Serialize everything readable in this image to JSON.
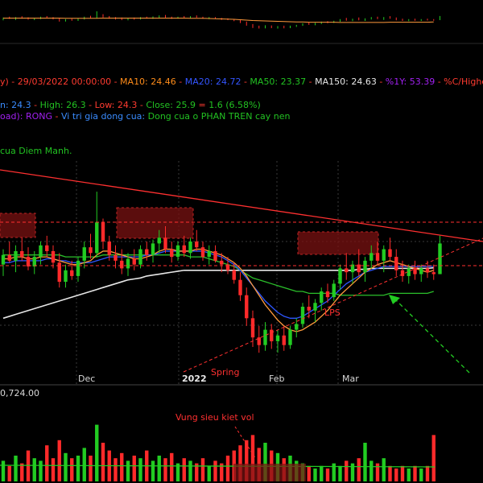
{
  "header": {
    "segments": [
      {
        "text": "y)",
        "color": "#ff3b30"
      },
      {
        "text": " - 29/03/2022 00:00:00 - ",
        "color": "#ff3b30"
      },
      {
        "text": "MA10: 24.46",
        "color": "#ff8c1a"
      },
      {
        "text": " - ",
        "color": "#ff3b30"
      },
      {
        "text": "MA20: 24.72",
        "color": "#3355ff"
      },
      {
        "text": " - ",
        "color": "#ff3b30"
      },
      {
        "text": "MA50: 23.37",
        "color": "#22c222"
      },
      {
        "text": " - ",
        "color": "#ff3b30"
      },
      {
        "text": "MA150: 24.63",
        "color": "#e8e8e8"
      },
      {
        "text": " - ",
        "color": "#ff3b30"
      },
      {
        "text": "%1Y: 53.39",
        "color": "#a020f0"
      },
      {
        "text": " - %C/Highe",
        "color": "#ff3b30"
      }
    ]
  },
  "ohlc": {
    "segments": [
      {
        "text": "n: 24.3",
        "color": "#3a8cff"
      },
      {
        "text": " - ",
        "color": "#ff3b30"
      },
      {
        "text": "High: 26.3",
        "color": "#22c222"
      },
      {
        "text": " - ",
        "color": "#ff3b30"
      },
      {
        "text": "Low: 24.3",
        "color": "#ff3b30"
      },
      {
        "text": " - ",
        "color": "#ff3b30"
      },
      {
        "text": "Close: 25.9",
        "color": "#22c222"
      },
      {
        "text": " = ",
        "color": "#ff3b30"
      },
      {
        "text": "1.6  (6.58%)",
        "color": "#22c222"
      }
    ]
  },
  "status": {
    "segments": [
      {
        "text": "oad): ",
        "color": "#a020f0"
      },
      {
        "text": "RONG",
        "color": "#a020f0"
      },
      {
        "text": "   -   ",
        "color": "#ff3b30"
      },
      {
        "text": "Vi tri gia dong cua:",
        "color": "#3a8cff"
      },
      {
        "text": "  Dong cua o PHAN TREN cay nen",
        "color": "#22c222"
      }
    ]
  },
  "note": {
    "text": "cua Diem Manh.",
    "color": "#22c222"
  },
  "annotations": {
    "lps": "LPS",
    "spring": "Spring",
    "vol_note": "Vung sieu kiet vol"
  },
  "volume_panel": {
    "value_label": "0,724.00"
  },
  "colors": {
    "background": "#000000",
    "up": "#22cc22",
    "down": "#ff2a2a",
    "ma10": "#ff9a3c",
    "ma20": "#2d56ff",
    "ma50": "#2bc02b",
    "ma150": "#e6e6e6",
    "trendline": "#ff3030",
    "resistance_box": "#7a1212",
    "grid": "#3a3a3a"
  },
  "chart_data": {
    "type": "candlestick",
    "x_ticks": [
      "Dec",
      "2022",
      "Feb",
      "Mar"
    ],
    "price_series": [
      {
        "o": 24.8,
        "h": 25.6,
        "l": 24.2,
        "c": 25.3
      },
      {
        "o": 25.3,
        "h": 26.0,
        "l": 24.9,
        "c": 25.0
      },
      {
        "o": 25.0,
        "h": 25.8,
        "l": 24.4,
        "c": 25.5
      },
      {
        "o": 25.5,
        "h": 26.2,
        "l": 25.0,
        "c": 25.2
      },
      {
        "o": 25.2,
        "h": 25.7,
        "l": 24.5,
        "c": 24.7
      },
      {
        "o": 24.7,
        "h": 25.5,
        "l": 24.3,
        "c": 25.2
      },
      {
        "o": 25.2,
        "h": 26.0,
        "l": 24.8,
        "c": 25.8
      },
      {
        "o": 25.8,
        "h": 26.3,
        "l": 25.2,
        "c": 25.5
      },
      {
        "o": 25.5,
        "h": 25.8,
        "l": 24.6,
        "c": 24.9
      },
      {
        "o": 24.9,
        "h": 25.4,
        "l": 23.6,
        "c": 23.9
      },
      {
        "o": 23.9,
        "h": 24.8,
        "l": 23.6,
        "c": 24.5
      },
      {
        "o": 24.5,
        "h": 25.0,
        "l": 24.0,
        "c": 24.2
      },
      {
        "o": 24.2,
        "h": 25.2,
        "l": 23.9,
        "c": 25.0
      },
      {
        "o": 25.0,
        "h": 26.0,
        "l": 24.6,
        "c": 25.7
      },
      {
        "o": 25.7,
        "h": 26.4,
        "l": 25.1,
        "c": 25.4
      },
      {
        "o": 25.4,
        "h": 28.6,
        "l": 25.2,
        "c": 27.0
      },
      {
        "o": 27.0,
        "h": 27.2,
        "l": 25.6,
        "c": 26.0
      },
      {
        "o": 26.0,
        "h": 26.3,
        "l": 25.0,
        "c": 25.3
      },
      {
        "o": 25.3,
        "h": 25.8,
        "l": 24.6,
        "c": 25.0
      },
      {
        "o": 25.0,
        "h": 25.6,
        "l": 24.3,
        "c": 24.6
      },
      {
        "o": 24.6,
        "h": 25.4,
        "l": 24.2,
        "c": 25.1
      },
      {
        "o": 25.1,
        "h": 25.6,
        "l": 24.5,
        "c": 24.8
      },
      {
        "o": 24.8,
        "h": 25.8,
        "l": 24.6,
        "c": 25.6
      },
      {
        "o": 25.6,
        "h": 26.0,
        "l": 25.0,
        "c": 25.3
      },
      {
        "o": 25.3,
        "h": 26.1,
        "l": 24.9,
        "c": 25.9
      },
      {
        "o": 25.9,
        "h": 26.6,
        "l": 25.4,
        "c": 26.2
      },
      {
        "o": 26.2,
        "h": 26.8,
        "l": 25.4,
        "c": 25.6
      },
      {
        "o": 25.6,
        "h": 26.0,
        "l": 24.9,
        "c": 25.2
      },
      {
        "o": 25.2,
        "h": 26.0,
        "l": 25.0,
        "c": 25.8
      },
      {
        "o": 25.8,
        "h": 26.3,
        "l": 25.2,
        "c": 25.4
      },
      {
        "o": 25.4,
        "h": 26.2,
        "l": 25.1,
        "c": 26.0
      },
      {
        "o": 26.0,
        "h": 26.6,
        "l": 25.5,
        "c": 25.7
      },
      {
        "o": 25.7,
        "h": 26.0,
        "l": 25.0,
        "c": 25.2
      },
      {
        "o": 25.2,
        "h": 25.8,
        "l": 24.8,
        "c": 25.5
      },
      {
        "o": 25.5,
        "h": 25.8,
        "l": 24.9,
        "c": 25.0
      },
      {
        "o": 25.0,
        "h": 25.4,
        "l": 24.4,
        "c": 24.8
      },
      {
        "o": 24.8,
        "h": 25.2,
        "l": 24.3,
        "c": 24.5
      },
      {
        "o": 24.5,
        "h": 24.9,
        "l": 23.8,
        "c": 24.0
      },
      {
        "o": 24.0,
        "h": 24.4,
        "l": 22.9,
        "c": 23.2
      },
      {
        "o": 23.2,
        "h": 23.6,
        "l": 21.6,
        "c": 22.0
      },
      {
        "o": 22.0,
        "h": 22.4,
        "l": 20.5,
        "c": 21.0
      },
      {
        "o": 21.0,
        "h": 21.6,
        "l": 20.2,
        "c": 20.6
      },
      {
        "o": 20.6,
        "h": 21.8,
        "l": 20.3,
        "c": 21.4
      },
      {
        "o": 21.4,
        "h": 21.7,
        "l": 20.4,
        "c": 20.8
      },
      {
        "o": 20.8,
        "h": 21.4,
        "l": 20.2,
        "c": 21.1
      },
      {
        "o": 21.1,
        "h": 21.6,
        "l": 20.3,
        "c": 20.6
      },
      {
        "o": 20.6,
        "h": 21.6,
        "l": 20.4,
        "c": 21.4
      },
      {
        "o": 21.4,
        "h": 22.0,
        "l": 21.0,
        "c": 21.7
      },
      {
        "o": 21.7,
        "h": 22.8,
        "l": 21.5,
        "c": 22.6
      },
      {
        "o": 22.6,
        "h": 23.2,
        "l": 22.0,
        "c": 22.4
      },
      {
        "o": 22.4,
        "h": 23.0,
        "l": 21.8,
        "c": 22.8
      },
      {
        "o": 22.8,
        "h": 23.6,
        "l": 22.4,
        "c": 23.4
      },
      {
        "o": 23.4,
        "h": 23.8,
        "l": 22.8,
        "c": 23.1
      },
      {
        "o": 23.1,
        "h": 24.0,
        "l": 22.9,
        "c": 23.8
      },
      {
        "o": 23.8,
        "h": 24.8,
        "l": 23.5,
        "c": 24.6
      },
      {
        "o": 24.6,
        "h": 25.4,
        "l": 24.0,
        "c": 24.4
      },
      {
        "o": 24.4,
        "h": 25.0,
        "l": 23.8,
        "c": 24.8
      },
      {
        "o": 24.8,
        "h": 25.6,
        "l": 24.2,
        "c": 24.4
      },
      {
        "o": 24.4,
        "h": 25.2,
        "l": 23.9,
        "c": 25.0
      },
      {
        "o": 25.0,
        "h": 25.8,
        "l": 24.6,
        "c": 25.4
      },
      {
        "o": 25.4,
        "h": 26.0,
        "l": 24.8,
        "c": 25.0
      },
      {
        "o": 25.0,
        "h": 25.8,
        "l": 24.4,
        "c": 25.6
      },
      {
        "o": 25.6,
        "h": 26.2,
        "l": 25.0,
        "c": 25.2
      },
      {
        "o": 25.2,
        "h": 25.6,
        "l": 24.2,
        "c": 24.5
      },
      {
        "o": 24.5,
        "h": 25.0,
        "l": 23.9,
        "c": 24.2
      },
      {
        "o": 24.2,
        "h": 24.8,
        "l": 23.8,
        "c": 24.6
      },
      {
        "o": 24.6,
        "h": 25.0,
        "l": 24.0,
        "c": 24.3
      },
      {
        "o": 24.3,
        "h": 24.8,
        "l": 23.9,
        "c": 24.6
      },
      {
        "o": 24.6,
        "h": 25.0,
        "l": 24.1,
        "c": 24.4
      },
      {
        "o": 24.4,
        "h": 24.8,
        "l": 24.0,
        "c": 24.3
      },
      {
        "o": 24.3,
        "h": 26.3,
        "l": 24.3,
        "c": 25.9
      }
    ],
    "ma10": [
      25.1,
      25.1,
      25.2,
      25.2,
      25.1,
      25.1,
      25.2,
      25.2,
      25.1,
      25.0,
      24.9,
      24.8,
      24.8,
      24.9,
      25.0,
      25.3,
      25.5,
      25.5,
      25.4,
      25.3,
      25.2,
      25.1,
      25.1,
      25.2,
      25.3,
      25.5,
      25.6,
      25.6,
      25.5,
      25.5,
      25.5,
      25.6,
      25.6,
      25.5,
      25.4,
      25.3,
      25.1,
      24.9,
      24.6,
      24.2,
      23.7,
      23.2,
      22.7,
      22.3,
      21.9,
      21.6,
      21.4,
      21.3,
      21.4,
      21.6,
      21.8,
      22.1,
      22.4,
      22.8,
      23.2,
      23.5,
      23.8,
      24.1,
      24.4,
      24.6,
      24.8,
      24.9,
      25.0,
      24.9,
      24.8,
      24.7,
      24.6,
      24.5,
      24.4,
      24.5
    ],
    "ma20": [
      24.9,
      24.9,
      25.0,
      25.0,
      25.0,
      25.0,
      25.0,
      25.1,
      25.1,
      25.0,
      25.0,
      24.9,
      24.9,
      24.9,
      24.9,
      25.0,
      25.1,
      25.2,
      25.2,
      25.2,
      25.2,
      25.2,
      25.2,
      25.3,
      25.3,
      25.4,
      25.5,
      25.5,
      25.5,
      25.5,
      25.5,
      25.5,
      25.5,
      25.4,
      25.3,
      25.2,
      25.0,
      24.8,
      24.5,
      24.1,
      23.7,
      23.3,
      22.9,
      22.6,
      22.3,
      22.1,
      22.0,
      22.0,
      22.1,
      22.3,
      22.5,
      22.7,
      22.9,
      23.2,
      23.5,
      23.8,
      24.0,
      24.2,
      24.4,
      24.5,
      24.6,
      24.7,
      24.7,
      24.7,
      24.7,
      24.7,
      24.7,
      24.7,
      24.7,
      24.7
    ],
    "ma50": [
      25.3,
      25.3,
      25.3,
      25.3,
      25.3,
      25.3,
      25.3,
      25.3,
      25.3,
      25.3,
      25.2,
      25.2,
      25.2,
      25.2,
      25.2,
      25.2,
      25.3,
      25.3,
      25.3,
      25.3,
      25.3,
      25.3,
      25.3,
      25.3,
      25.3,
      25.3,
      25.3,
      25.3,
      25.3,
      25.3,
      25.2,
      25.2,
      25.2,
      25.1,
      25.0,
      24.9,
      24.8,
      24.7,
      24.5,
      24.3,
      24.1,
      24.0,
      23.9,
      23.8,
      23.7,
      23.6,
      23.5,
      23.4,
      23.4,
      23.3,
      23.3,
      23.3,
      23.3,
      23.3,
      23.2,
      23.2,
      23.2,
      23.2,
      23.2,
      23.2,
      23.2,
      23.2,
      23.3,
      23.3,
      23.3,
      23.3,
      23.3,
      23.3,
      23.3,
      23.4
    ],
    "ma150": [
      22.0,
      22.1,
      22.2,
      22.3,
      22.4,
      22.5,
      22.6,
      22.7,
      22.8,
      22.9,
      23.0,
      23.1,
      23.2,
      23.3,
      23.4,
      23.5,
      23.6,
      23.7,
      23.8,
      23.9,
      24.0,
      24.05,
      24.1,
      24.2,
      24.25,
      24.3,
      24.35,
      24.4,
      24.45,
      24.5,
      24.5,
      24.5,
      24.5,
      24.5,
      24.5,
      24.5,
      24.5,
      24.5,
      24.5,
      24.5,
      24.5,
      24.5,
      24.5,
      24.5,
      24.5,
      24.5,
      24.5,
      24.5,
      24.5,
      24.5,
      24.5,
      24.5,
      24.5,
      24.5,
      24.5,
      24.5,
      24.5,
      24.55,
      24.55,
      24.6,
      24.6,
      24.6,
      24.6,
      24.6,
      24.6,
      24.6,
      24.6,
      24.6,
      24.6,
      24.63
    ],
    "volume": [
      0.8,
      0.6,
      1.0,
      0.7,
      1.2,
      0.9,
      0.8,
      1.4,
      0.9,
      1.6,
      1.1,
      0.9,
      1.0,
      1.3,
      1.0,
      2.2,
      1.5,
      1.2,
      0.9,
      1.1,
      0.8,
      1.0,
      0.9,
      1.2,
      0.8,
      1.0,
      0.9,
      1.1,
      0.7,
      0.9,
      0.8,
      0.7,
      0.9,
      0.6,
      0.8,
      0.7,
      1.0,
      1.2,
      1.4,
      1.6,
      1.8,
      1.3,
      1.5,
      1.2,
      1.1,
      0.9,
      1.0,
      0.8,
      0.7,
      0.6,
      0.5,
      0.6,
      0.5,
      0.7,
      0.6,
      0.8,
      0.7,
      0.9,
      1.5,
      0.8,
      0.7,
      0.9,
      0.6,
      0.5,
      0.6,
      0.5,
      0.6,
      0.5,
      0.6,
      1.8
    ]
  }
}
